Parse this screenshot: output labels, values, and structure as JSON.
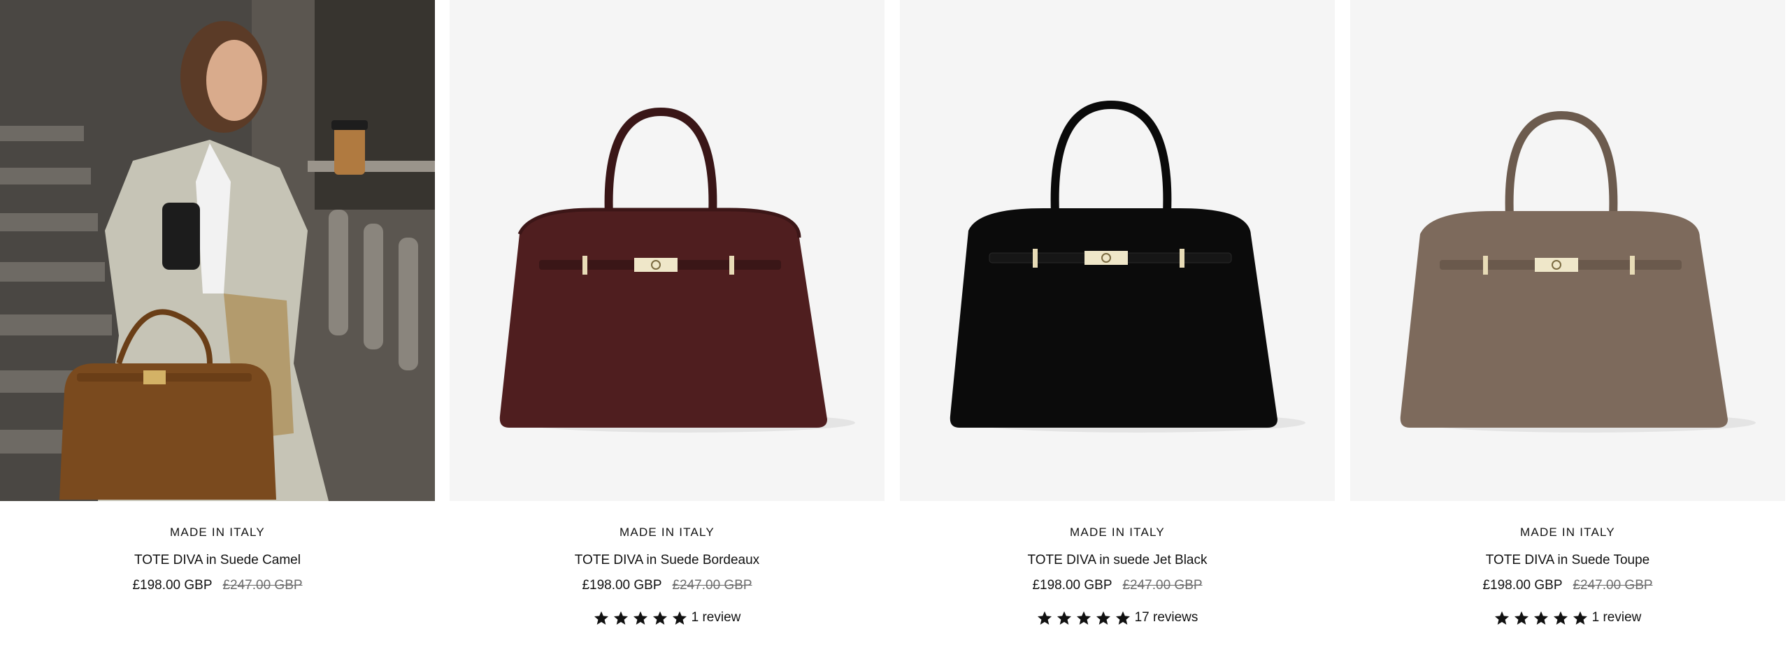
{
  "products": [
    {
      "eyebrow": "MADE IN ITALY",
      "title": "TOTE DIVA in Suede Camel",
      "price": "£198.00 GBP",
      "compare_price": "£247.00 GBP",
      "image": "lifestyle-photo",
      "rating": null,
      "review_text": ""
    },
    {
      "eyebrow": "MADE IN ITALY",
      "title": "TOTE DIVA in Suede Bordeaux",
      "price": "£198.00 GBP",
      "compare_price": "£247.00 GBP",
      "image": "handbag-bordeaux",
      "color": "#4f1e1f",
      "rating": 5,
      "review_text": "1 review"
    },
    {
      "eyebrow": "MADE IN ITALY",
      "title": "TOTE DIVA in suede Jet Black",
      "price": "£198.00 GBP",
      "compare_price": "£247.00 GBP",
      "image": "handbag-black",
      "color": "#0b0b0b",
      "rating": 5,
      "review_text": "17 reviews"
    },
    {
      "eyebrow": "MADE IN ITALY",
      "title": "TOTE DIVA in Suede Toupe",
      "price": "£198.00 GBP",
      "compare_price": "£247.00 GBP",
      "image": "handbag-toupe",
      "color": "#7d6a5c",
      "rating": 5,
      "review_text": "1 review"
    }
  ]
}
